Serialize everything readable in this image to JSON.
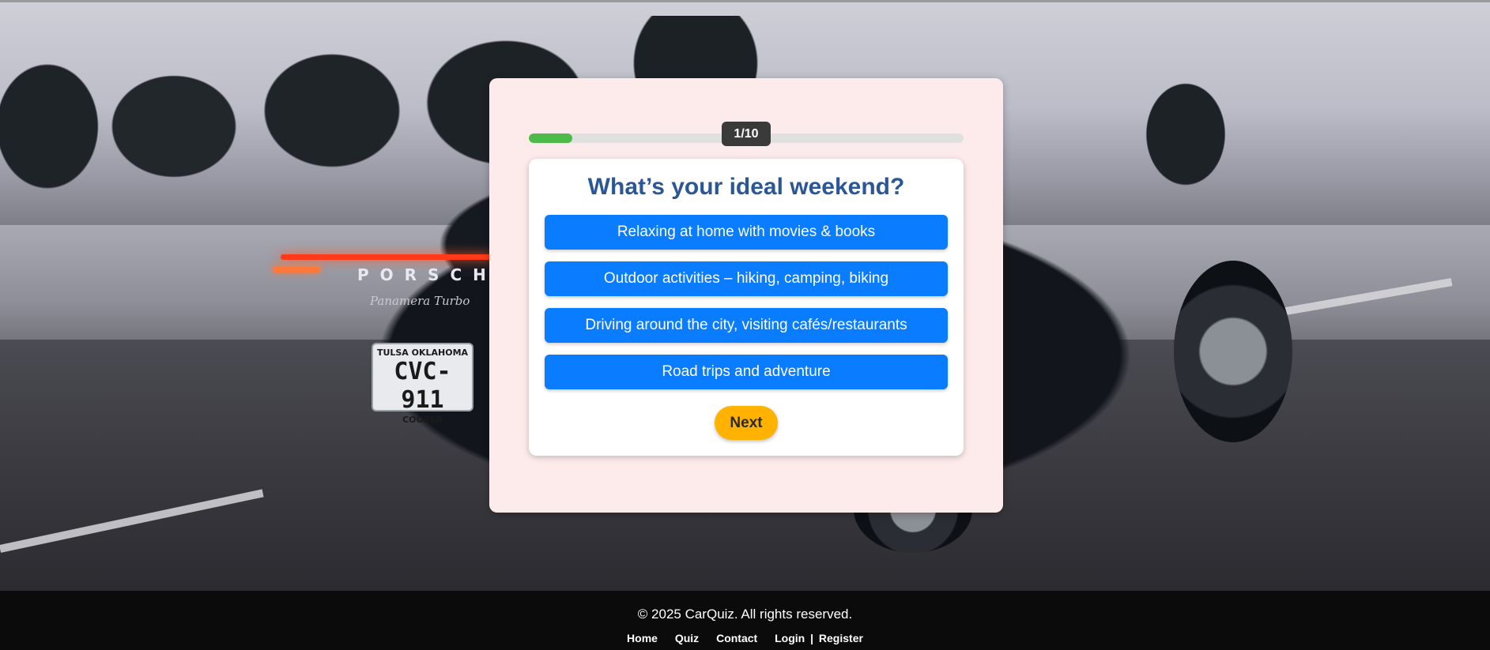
{
  "progress": {
    "label": "1/10",
    "fraction": 0.1,
    "fill_color": "#4cbb4a",
    "track_color": "#e0e0e0"
  },
  "question": {
    "title": "What’s your ideal weekend?",
    "options": [
      "Relaxing at home with movies & books",
      "Outdoor activities – hiking, camping, biking",
      "Driving around the city, visiting cafés/restaurants",
      "Road trips and adventure"
    ],
    "next_label": "Next"
  },
  "background_photo": {
    "subject": "car-photo",
    "badge": "PORSCHE",
    "model": "Panamera Turbo",
    "plate": {
      "top": "TULSA OKLAHOMA",
      "number": "CVC-911",
      "bottom": "COOPER"
    }
  },
  "footer": {
    "copyright": "© 2025 CarQuiz. All rights reserved.",
    "nav": {
      "home": "Home",
      "quiz": "Quiz",
      "contact": "Contact",
      "login": "Login",
      "separator": "|",
      "register": "Register"
    }
  },
  "colors": {
    "panel_bg": "#fdeaea",
    "title": "#2b5797",
    "option_bg": "#0a7cff",
    "next_bg": "#ffb300",
    "footer_bg": "#0b0b0b"
  }
}
